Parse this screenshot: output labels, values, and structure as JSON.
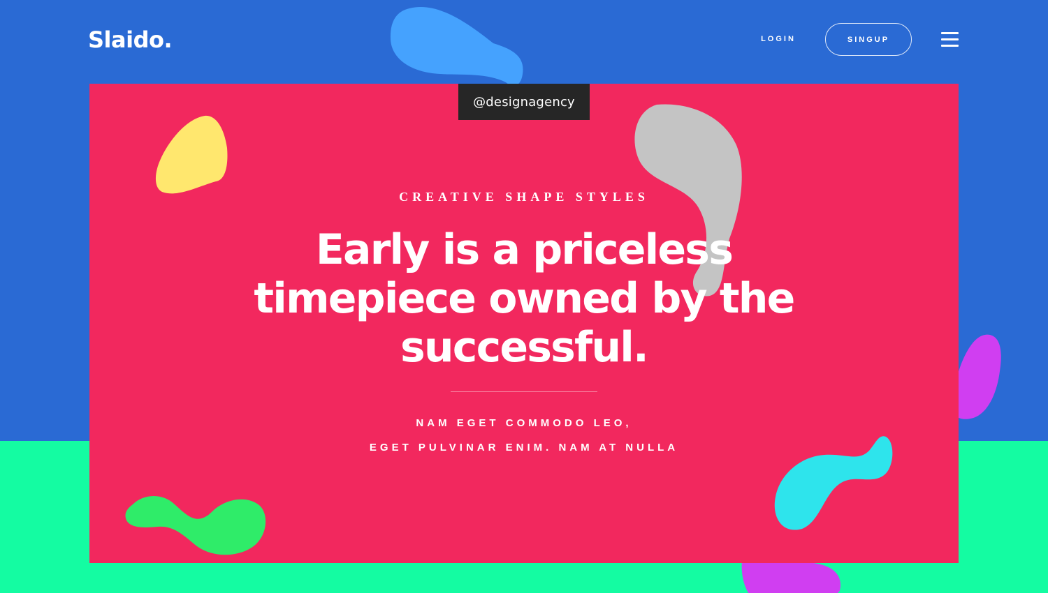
{
  "brand": {
    "logo_text": "Slaido."
  },
  "nav": {
    "login_label": "LOGIN",
    "signup_label": "SINGUP",
    "menu_icon": "hamburger-menu-icon"
  },
  "hero": {
    "handle": "@designagency",
    "eyebrow": "CREATIVE SHAPE STYLES",
    "headline": "Early is a priceless timepiece owned by the successful.",
    "subline_1": "NAM EGET COMMODO LEO,",
    "subline_2": "EGET PULVINAR ENIM. NAM AT NULLA"
  },
  "colors": {
    "background_top": "#2a6ad4",
    "background_bottom": "#14fca2",
    "card": "#f2285e",
    "handle_tag": "#262626",
    "blob_blue": "#45a2fe",
    "blob_yellow": "#ffe76e",
    "blob_gray": "#c4c4c4",
    "blob_purple": "#d03ef1",
    "blob_cyan": "#2ee4ec",
    "blob_green": "#2fec69"
  }
}
